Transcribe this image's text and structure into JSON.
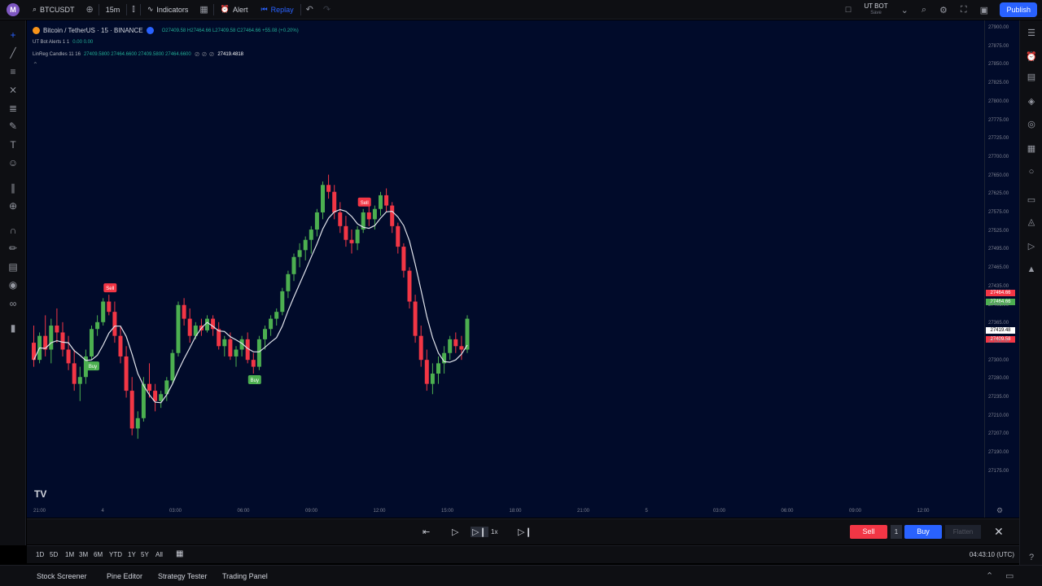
{
  "topbar": {
    "avatar": "M",
    "symbol": "BTCUSDT",
    "interval": "15m",
    "indicators": "Indicators",
    "alert": "Alert",
    "replay": "Replay",
    "layout_name": "UT BOT",
    "layout_sub": "Save",
    "publish": "Publish"
  },
  "legend": {
    "title": "Bitcoin / TetherUS · 15 · BINANCE",
    "ohlc": "O27409.58 H27464.66 L27409.58 C27464.66 +55.08 (+0.20%)",
    "ind1": "UT Bot Alerts 1 1",
    "ind1_vals": "0.00 0.00",
    "ind2": "LinReg Candles 11 16",
    "ind2_vals": "27409.5800 27464.6600 27409.5800 27464.6600",
    "ind2_last": "27419.4818"
  },
  "price_axis": {
    "ticks": [
      "27900.00",
      "27875.00",
      "27850.00",
      "27825.00",
      "27800.00",
      "27775.00",
      "27725.00",
      "27700.00",
      "27650.00",
      "27625.00",
      "27575.00",
      "27525.00",
      "27495.00",
      "27465.00",
      "27435.00",
      "27405.00",
      "27365.00",
      "27335.00",
      "27300.00",
      "27280.00",
      "27235.00",
      "27210.00",
      "27207.00",
      "27190.00",
      "27175.00"
    ],
    "label_red": "27464.66",
    "label_green": "27464.66",
    "label_white": "27419.48",
    "label_red2": "27409.58"
  },
  "time_axis": {
    "ticks": [
      "21:00",
      "4",
      "03:00",
      "06:00",
      "09:00",
      "12:00",
      "15:00",
      "18:00",
      "21:00",
      "5",
      "03:00",
      "06:00",
      "09:00",
      "12:00"
    ]
  },
  "signals": {
    "buy": "Buy",
    "sell": "Sell"
  },
  "replay": {
    "speed": "1x",
    "sell": "Sell",
    "qty": "1",
    "buy": "Buy",
    "flatten": "Flatten"
  },
  "ranges": [
    "1D",
    "5D",
    "1M",
    "3M",
    "6M",
    "YTD",
    "1Y",
    "5Y",
    "All"
  ],
  "clock": "04:43:10 (UTC)",
  "bottom_tabs": [
    "Stock Screener",
    "Pine Editor",
    "Strategy Tester",
    "Trading Panel"
  ],
  "colors": {
    "up": "#4caf50",
    "down": "#f23645",
    "bg": "#010b2a",
    "accent": "#2962ff"
  },
  "chart_data": {
    "type": "candlestick",
    "price_range": [
      27175,
      27900
    ],
    "candles": [
      [
        27430,
        27455,
        27395,
        27405
      ],
      [
        27405,
        27445,
        27400,
        27440
      ],
      [
        27440,
        27470,
        27410,
        27420
      ],
      [
        27420,
        27465,
        27400,
        27455
      ],
      [
        27455,
        27480,
        27430,
        27445
      ],
      [
        27445,
        27460,
        27410,
        27420
      ],
      [
        27420,
        27440,
        27390,
        27400
      ],
      [
        27400,
        27420,
        27360,
        27370
      ],
      [
        27370,
        27395,
        27345,
        27380
      ],
      [
        27380,
        27420,
        27370,
        27410
      ],
      [
        27410,
        27455,
        27405,
        27450
      ],
      [
        27450,
        27470,
        27440,
        27460
      ],
      [
        27460,
        27495,
        27455,
        27490
      ],
      [
        27490,
        27500,
        27470,
        27475
      ],
      [
        27475,
        27490,
        27430,
        27440
      ],
      [
        27440,
        27455,
        27400,
        27410
      ],
      [
        27410,
        27425,
        27350,
        27360
      ],
      [
        27360,
        27380,
        27295,
        27305
      ],
      [
        27305,
        27330,
        27290,
        27320
      ],
      [
        27320,
        27380,
        27315,
        27370
      ],
      [
        27370,
        27400,
        27350,
        27360
      ],
      [
        27360,
        27370,
        27330,
        27345
      ],
      [
        27345,
        27360,
        27335,
        27355
      ],
      [
        27355,
        27380,
        27345,
        27375
      ],
      [
        27375,
        27420,
        27370,
        27415
      ],
      [
        27415,
        27490,
        27410,
        27485
      ],
      [
        27485,
        27495,
        27455,
        27465
      ],
      [
        27465,
        27480,
        27430,
        27440
      ],
      [
        27440,
        27460,
        27435,
        27455
      ],
      [
        27455,
        27465,
        27440,
        27448
      ],
      [
        27448,
        27470,
        27445,
        27465
      ],
      [
        27465,
        27470,
        27440,
        27450
      ],
      [
        27450,
        27460,
        27420,
        27425
      ],
      [
        27425,
        27440,
        27410,
        27435
      ],
      [
        27435,
        27445,
        27405,
        27410
      ],
      [
        27410,
        27425,
        27395,
        27420
      ],
      [
        27420,
        27440,
        27410,
        27435
      ],
      [
        27435,
        27445,
        27400,
        27405
      ],
      [
        27405,
        27415,
        27385,
        27395
      ],
      [
        27395,
        27440,
        27390,
        27435
      ],
      [
        27435,
        27455,
        27420,
        27450
      ],
      [
        27450,
        27470,
        27440,
        27465
      ],
      [
        27465,
        27480,
        27455,
        27475
      ],
      [
        27475,
        27510,
        27470,
        27505
      ],
      [
        27505,
        27535,
        27495,
        27530
      ],
      [
        27530,
        27560,
        27520,
        27555
      ],
      [
        27555,
        27575,
        27540,
        27565
      ],
      [
        27565,
        27585,
        27550,
        27580
      ],
      [
        27580,
        27600,
        27560,
        27595
      ],
      [
        27595,
        27625,
        27585,
        27620
      ],
      [
        27620,
        27665,
        27610,
        27660
      ],
      [
        27660,
        27675,
        27640,
        27650
      ],
      [
        27650,
        27660,
        27610,
        27620
      ],
      [
        27620,
        27635,
        27590,
        27600
      ],
      [
        27600,
        27615,
        27570,
        27580
      ],
      [
        27580,
        27595,
        27560,
        27575
      ],
      [
        27575,
        27600,
        27565,
        27595
      ],
      [
        27595,
        27625,
        27590,
        27620
      ],
      [
        27620,
        27640,
        27600,
        27610
      ],
      [
        27610,
        27630,
        27595,
        27625
      ],
      [
        27625,
        27650,
        27615,
        27645
      ],
      [
        27645,
        27655,
        27620,
        27630
      ],
      [
        27630,
        27635,
        27590,
        27600
      ],
      [
        27600,
        27605,
        27560,
        27570
      ],
      [
        27570,
        27575,
        27525,
        27535
      ],
      [
        27535,
        27540,
        27480,
        27490
      ],
      [
        27490,
        27500,
        27430,
        27440
      ],
      [
        27440,
        27455,
        27395,
        27405
      ],
      [
        27405,
        27420,
        27360,
        27370
      ],
      [
        27370,
        27400,
        27355,
        27385
      ],
      [
        27385,
        27410,
        27370,
        27400
      ],
      [
        27400,
        27425,
        27385,
        27415
      ],
      [
        27415,
        27440,
        27405,
        27435
      ],
      [
        27435,
        27445,
        27415,
        27425
      ],
      [
        27425,
        27440,
        27405,
        27420
      ],
      [
        27420,
        27470,
        27415,
        27465
      ]
    ],
    "signals": [
      {
        "index": 10,
        "type": "buy"
      },
      {
        "index": 13,
        "type": "sell"
      },
      {
        "index": 38,
        "type": "buy"
      },
      {
        "index": 57,
        "type": "sell"
      }
    ]
  }
}
